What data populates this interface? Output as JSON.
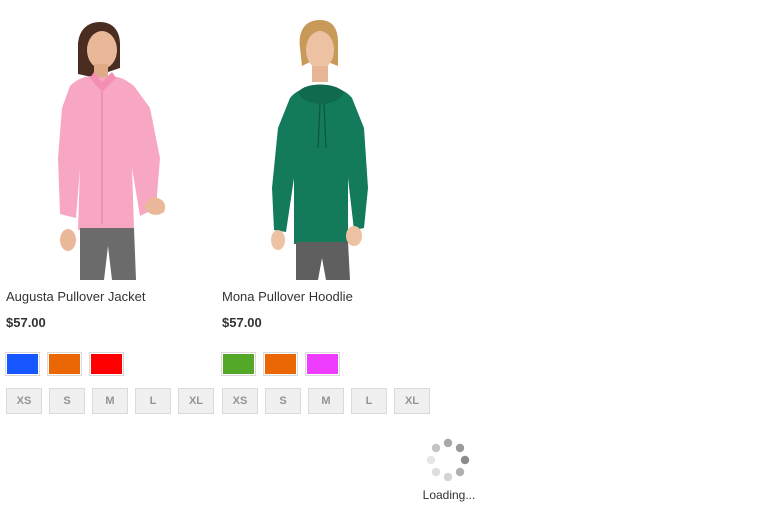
{
  "products": [
    {
      "name": "Augusta Pullover Jacket",
      "price": "$57.00",
      "image_alt": "Woman wearing pink pullover jacket",
      "colors": [
        {
          "name": "Blue",
          "hex": "#1757ff"
        },
        {
          "name": "Orange",
          "hex": "#eb6703"
        },
        {
          "name": "Red",
          "hex": "#ff0000"
        }
      ],
      "sizes": [
        "XS",
        "S",
        "M",
        "L",
        "XL"
      ]
    },
    {
      "name": "Mona Pullover Hoodlie",
      "price": "$57.00",
      "image_alt": "Woman wearing green pullover hoodie",
      "colors": [
        {
          "name": "Green",
          "hex": "#53a828"
        },
        {
          "name": "Orange",
          "hex": "#eb6703"
        },
        {
          "name": "Purple",
          "hex": "#ef3dff"
        }
      ],
      "sizes": [
        "XS",
        "S",
        "M",
        "L",
        "XL"
      ]
    }
  ],
  "loader": {
    "text": "Loading..."
  }
}
